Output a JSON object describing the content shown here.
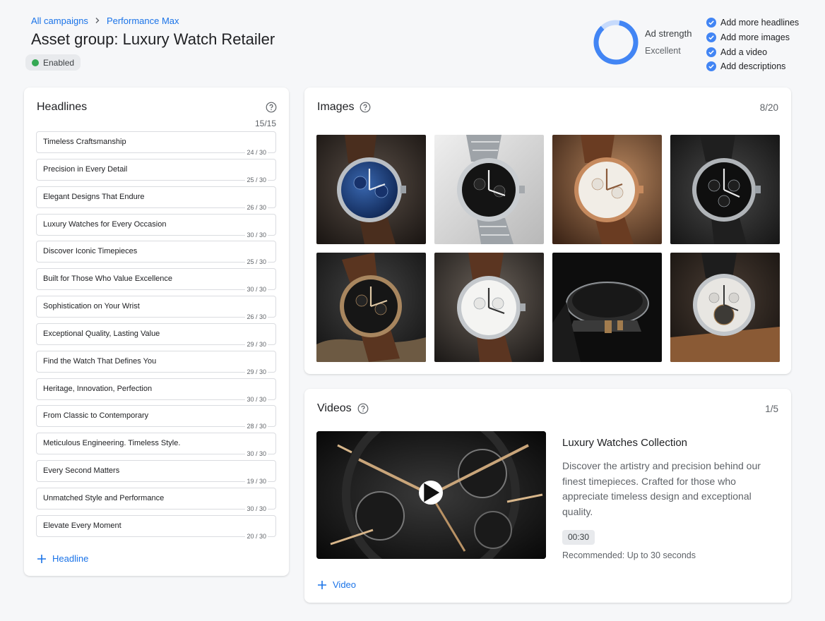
{
  "breadcrumb": {
    "items": [
      "All campaigns",
      "Performance Max"
    ]
  },
  "page": {
    "title": "Asset group: Luxury Watch Retailer",
    "status": "Enabled"
  },
  "ad_strength": {
    "label": "Ad strength",
    "value": "Excellent"
  },
  "checklist": [
    "Add more headlines",
    "Add more images",
    "Add a video",
    "Add descriptions"
  ],
  "headlines": {
    "title": "Headlines",
    "count": "15/15",
    "add_label": "Headline",
    "items": [
      {
        "text": "Timeless Craftsmanship",
        "chars": "24 / 30"
      },
      {
        "text": "Precision in Every Detail",
        "chars": "25 / 30"
      },
      {
        "text": "Elegant Designs That Endure",
        "chars": "26 / 30"
      },
      {
        "text": "Luxury Watches for Every Occasion",
        "chars": "30 / 30"
      },
      {
        "text": "Discover Iconic Timepieces",
        "chars": "25 / 30"
      },
      {
        "text": "Built for Those Who Value Excellence",
        "chars": "30 / 30"
      },
      {
        "text": "Sophistication on Your Wrist",
        "chars": "26 / 30"
      },
      {
        "text": "Exceptional Quality, Lasting Value",
        "chars": "29 / 30"
      },
      {
        "text": "Find the Watch That Defines You",
        "chars": "29 / 30"
      },
      {
        "text": "Heritage, Innovation, Perfection",
        "chars": "30 / 30"
      },
      {
        "text": "From Classic to Contemporary",
        "chars": "28 / 30"
      },
      {
        "text": "Meticulous Engineering. Timeless Style.",
        "chars": "30 / 30"
      },
      {
        "text": "Every Second Matters",
        "chars": "19 / 30"
      },
      {
        "text": "Unmatched Style and Performance",
        "chars": "30 / 30"
      },
      {
        "text": "Elevate Every Moment",
        "chars": "20 / 30"
      }
    ]
  },
  "images": {
    "title": "Images",
    "count": "8/20"
  },
  "videos": {
    "title": "Videos",
    "count": "1/5",
    "add_label": "Video",
    "item": {
      "title": "Luxury Watches Collection",
      "description": "Discover the artistry and precision behind our finest timepieces. Crafted for those who appreciate timeless design and exceptional quality.",
      "duration": "00:30",
      "recommendation": "Recommended: Up to 30 seconds"
    }
  },
  "colors": {
    "accent": "#1a73e8",
    "enabled": "#34a853",
    "strength_ring": "#4285f4"
  }
}
